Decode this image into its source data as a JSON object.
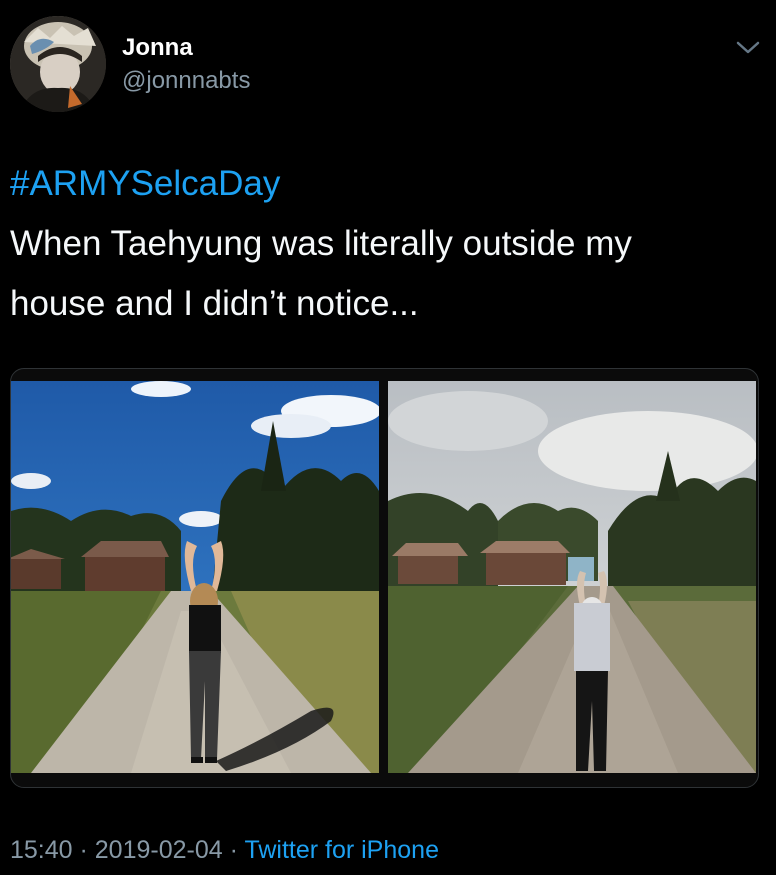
{
  "tweet": {
    "author": {
      "display_name": "Jonna",
      "handle": "@jonnnabts",
      "avatar_icon": "profile-photo"
    },
    "menu_icon": "chevron-down-icon",
    "hashtag": "#ARMYSelcaDay",
    "text_line1": "When Taehyung was literally outside my",
    "text_line2": "house and I didn’t notice...",
    "media": [
      {
        "name": "photo-left",
        "description_icon": "photo"
      },
      {
        "name": "photo-right",
        "description_icon": "photo"
      }
    ],
    "meta": {
      "time": "15:40",
      "separator": " · ",
      "date": "2019-02-04",
      "source": "Twitter for iPhone"
    }
  },
  "colors": {
    "background": "#000000",
    "link": "#1da1f2",
    "muted": "#8899a6",
    "text": "#f5f8fa"
  }
}
